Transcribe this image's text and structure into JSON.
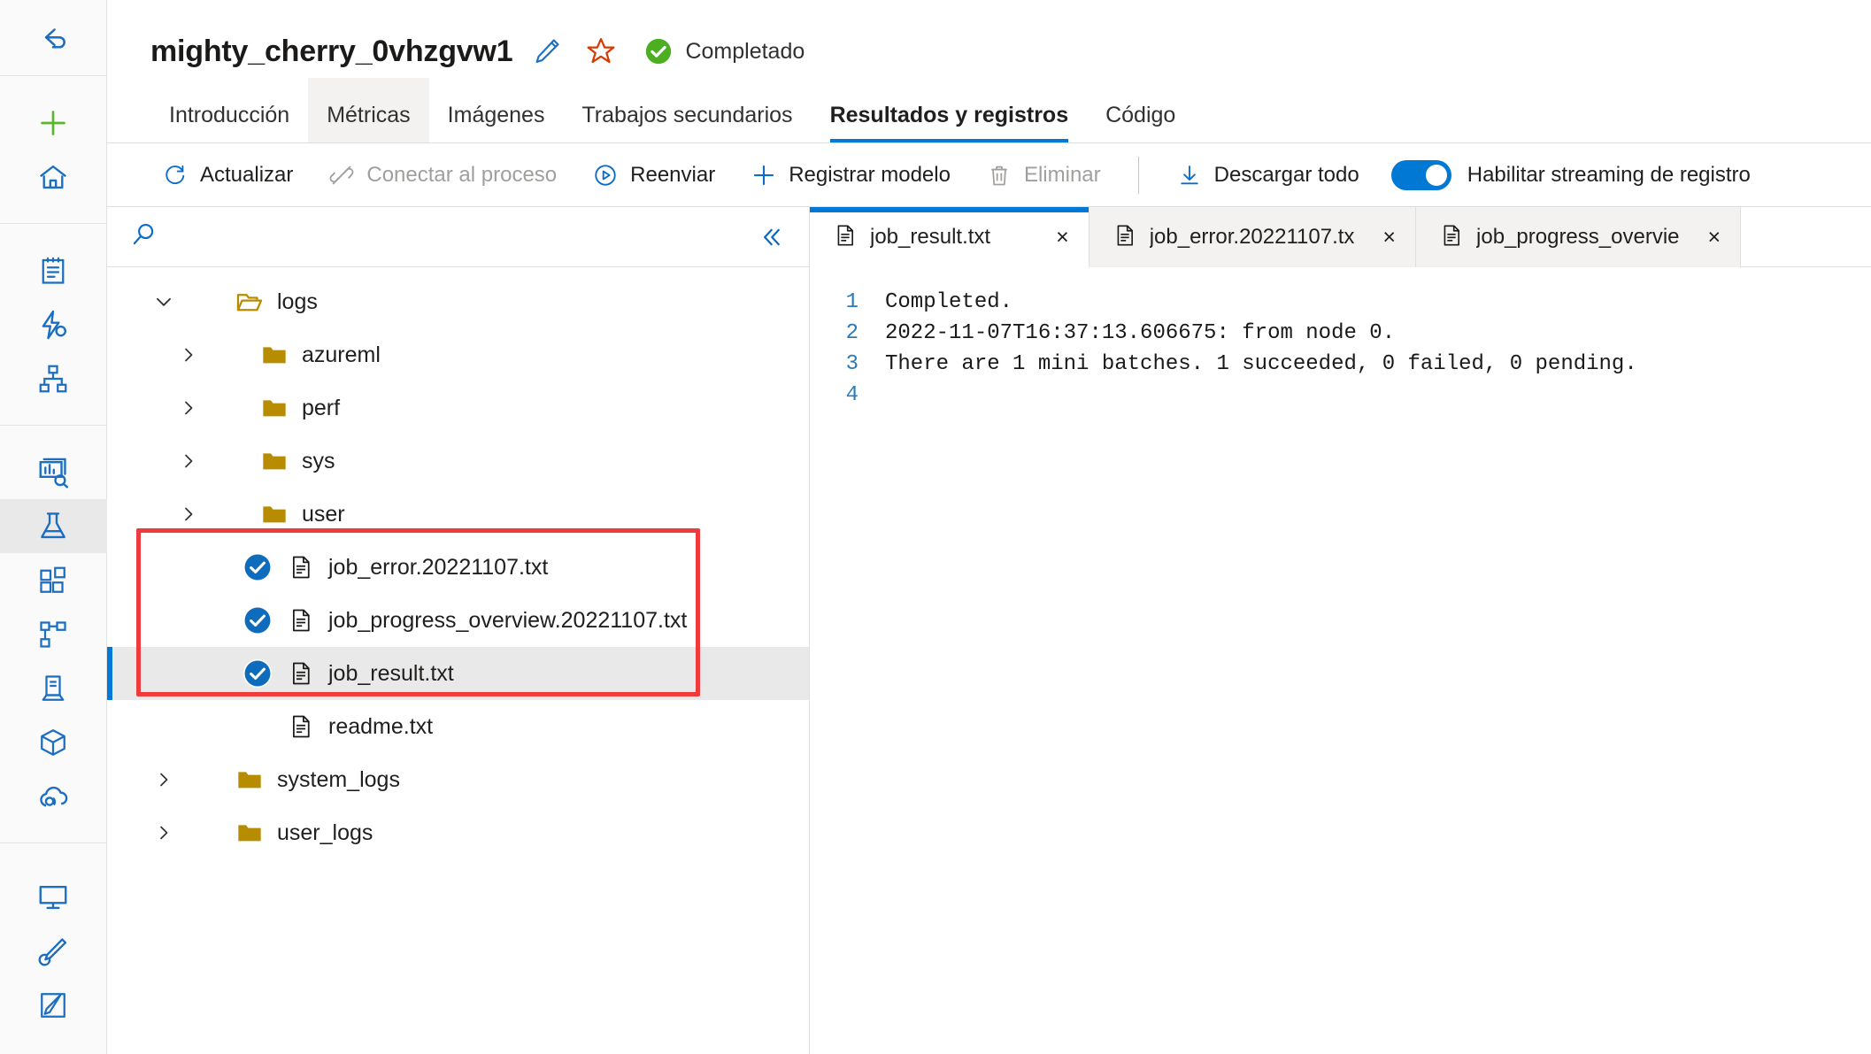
{
  "rail": {
    "items": [
      {
        "name": "back-arrow-icon",
        "label": "Atrás",
        "group": 0,
        "selected": false
      },
      {
        "name": "add-new-icon",
        "label": "Nuevo",
        "group": 1,
        "selected": false
      },
      {
        "name": "home-icon",
        "label": "Inicio",
        "group": 1,
        "selected": false
      },
      {
        "name": "notebooks-icon",
        "label": "Cuadernos",
        "group": 2,
        "selected": false
      },
      {
        "name": "automated-ml-icon",
        "label": "ML automatizado",
        "group": 2,
        "selected": false
      },
      {
        "name": "designer-icon",
        "label": "Diseñador",
        "group": 2,
        "selected": false
      },
      {
        "name": "data-monitor-icon",
        "label": "Supervisión",
        "group": 3,
        "selected": false
      },
      {
        "name": "jobs-flask-icon",
        "label": "Trabajos",
        "group": 3,
        "selected": true
      },
      {
        "name": "components-icon",
        "label": "Componentes",
        "group": 3,
        "selected": false
      },
      {
        "name": "pipelines-icon",
        "label": "Canalizaciones",
        "group": 3,
        "selected": false
      },
      {
        "name": "environments-icon",
        "label": "Entornos",
        "group": 3,
        "selected": false
      },
      {
        "name": "models-cube-icon",
        "label": "Modelos",
        "group": 3,
        "selected": false
      },
      {
        "name": "endpoints-cloud-icon",
        "label": "Puntos de conexión",
        "group": 3,
        "selected": false
      },
      {
        "name": "compute-monitor-icon",
        "label": "Proceso",
        "group": 4,
        "selected": false
      },
      {
        "name": "data-labeling-icon",
        "label": "Etiquetado de datos",
        "group": 4,
        "selected": false
      },
      {
        "name": "linked-services-icon",
        "label": "Servicios vinculados",
        "group": 4,
        "selected": false
      }
    ]
  },
  "header": {
    "job_title": "mighty_cherry_0vhzgvw1",
    "edit_icon": "pencil-icon",
    "favorite_icon": "star-icon",
    "status_icon": "check-circle-icon",
    "status_text": "Completado",
    "status_color": "#4caf22"
  },
  "tabs": [
    {
      "label": "Introducción",
      "state": "normal"
    },
    {
      "label": "Métricas",
      "state": "hovered"
    },
    {
      "label": "Imágenes",
      "state": "normal"
    },
    {
      "label": "Trabajos secundarios",
      "state": "normal"
    },
    {
      "label": "Resultados y registros",
      "state": "active"
    },
    {
      "label": "Código",
      "state": "normal"
    }
  ],
  "toolbar": {
    "accent_color": "#0078d4",
    "commands": [
      {
        "label": "Actualizar",
        "icon": "refresh-icon",
        "disabled": false
      },
      {
        "label": "Conectar al proceso",
        "icon": "unlink-icon",
        "disabled": true
      },
      {
        "label": "Reenviar",
        "icon": "play-circle-icon",
        "disabled": false
      },
      {
        "label": "Registrar modelo",
        "icon": "plus-icon",
        "disabled": false
      },
      {
        "label": "Eliminar",
        "icon": "trash-icon",
        "disabled": true
      }
    ],
    "download_all": {
      "label": "Descargar todo",
      "icon": "download-icon"
    },
    "streaming_toggle": {
      "label": "Habilitar streaming de registro",
      "on": true
    }
  },
  "tree_panel": {
    "search_placeholder": "",
    "search_value": "",
    "search_icon": "search-icon",
    "collapse_icon": "double-chevron-left-icon",
    "nodes": [
      {
        "label": "logs",
        "type": "folder-open",
        "indent": 0,
        "chevron": "down",
        "checkbox": null,
        "selected": false
      },
      {
        "label": "azureml",
        "type": "folder",
        "indent": 1,
        "chevron": "right",
        "checkbox": null,
        "selected": false
      },
      {
        "label": "perf",
        "type": "folder",
        "indent": 1,
        "chevron": "right",
        "checkbox": null,
        "selected": false
      },
      {
        "label": "sys",
        "type": "folder",
        "indent": 1,
        "chevron": "right",
        "checkbox": null,
        "selected": false
      },
      {
        "label": "user",
        "type": "folder",
        "indent": 1,
        "chevron": "right",
        "checkbox": null,
        "selected": false
      },
      {
        "label": "job_error.20221107.txt",
        "type": "file",
        "indent": 2,
        "chevron": "none",
        "checkbox": "checked",
        "selected": false
      },
      {
        "label": "job_progress_overview.20221107.txt",
        "type": "file",
        "indent": 2,
        "chevron": "none",
        "checkbox": "checked",
        "selected": false
      },
      {
        "label": "job_result.txt",
        "type": "file",
        "indent": 2,
        "chevron": "none",
        "checkbox": "checked",
        "selected": true
      },
      {
        "label": "readme.txt",
        "type": "file",
        "indent": 2,
        "chevron": "none",
        "checkbox": null,
        "selected": false
      },
      {
        "label": "system_logs",
        "type": "folder",
        "indent": 1,
        "chevron": "right",
        "checkbox": null,
        "selected": false
      },
      {
        "label": "user_logs",
        "type": "folder",
        "indent": 1,
        "chevron": "right",
        "checkbox": null,
        "selected": false
      }
    ],
    "annotation": {
      "color": "#ef3b3b",
      "shape": "rectangle"
    }
  },
  "file_tabs": [
    {
      "label": "job_result.txt",
      "icon": "text-file-icon",
      "close_icon": "×",
      "active": true
    },
    {
      "label": "job_error.20221107.tx",
      "icon": "text-file-icon",
      "close_icon": "×",
      "active": false
    },
    {
      "label": "job_progress_overvie",
      "icon": "text-file-icon",
      "close_icon": "×",
      "active": false
    }
  ],
  "log": {
    "lines": [
      {
        "n": "1",
        "text": "Completed."
      },
      {
        "n": "2",
        "text": "2022-11-07T16:37:13.606675: from node 0."
      },
      {
        "n": "3",
        "text": "There are 1 mini batches. 1 succeeded, 0 failed, 0 pending."
      },
      {
        "n": "4",
        "text": ""
      }
    ]
  }
}
